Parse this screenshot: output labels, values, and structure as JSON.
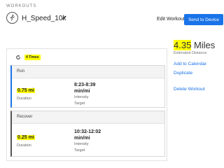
{
  "header": {
    "section_label": "WORKOUTS",
    "workout_name": "H_Speed_10k",
    "edit_workout_label": "Edit Workout",
    "send_button_label": "Send to Device"
  },
  "repeat": {
    "count_label": "4 Times"
  },
  "steps": [
    {
      "type": "Run",
      "distance": "0.75 mi",
      "duration_label": "Duration",
      "pace_line1": "8:23-8:39",
      "pace_line2": "min/mi",
      "intensity_label": "Intensity",
      "target_label": "Target"
    },
    {
      "type": "Recover",
      "distance": "0.25 mi",
      "duration_label": "Duration",
      "pace_line1": "10:32-12:02",
      "pace_line2": "min/mi",
      "intensity_label": "Intensity",
      "target_label": "Target"
    }
  ],
  "summary": {
    "distance_value": "4.35",
    "distance_unit": "Miles",
    "estimated_label": "Estimated Distance"
  },
  "actions": {
    "add_to_calendar": "Add to Calendar",
    "duplicate": "Duplicate",
    "delete_workout": "Delete Workout"
  },
  "colors": {
    "accent": "#1a73e8",
    "highlight": "#ffff00",
    "recover_bar": "#555555"
  },
  "icons": {
    "workout": "runner-icon",
    "edit": "pencil-icon",
    "repeat": "repeat-icon"
  }
}
